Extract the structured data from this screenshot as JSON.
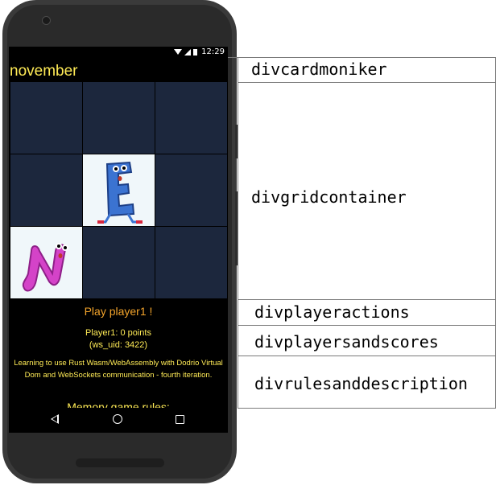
{
  "device": {
    "status_time": "12:29"
  },
  "app": {
    "card_moniker": "november",
    "grid_cards": [
      {
        "state": "closed",
        "letter": ""
      },
      {
        "state": "closed",
        "letter": ""
      },
      {
        "state": "closed",
        "letter": ""
      },
      {
        "state": "closed",
        "letter": ""
      },
      {
        "state": "open",
        "letter": "E"
      },
      {
        "state": "closed",
        "letter": ""
      },
      {
        "state": "open",
        "letter": "N"
      },
      {
        "state": "closed",
        "letter": ""
      },
      {
        "state": "closed",
        "letter": ""
      }
    ],
    "player_action": "Play player1 !",
    "player_score_line1": "Player1: 0 points",
    "player_score_line2": "(ws_uid: 3422)",
    "rules_description": "Learning to use Rust Wasm/WebAssembly with Dodrio Virtual Dom and WebSockets communication - fourth iteration.",
    "rules_title": "Memory game rules:"
  },
  "annotations": {
    "card_moniker": "divcardmoniker",
    "grid_container": "divgridcontainer",
    "player_actions": "divplayeractions",
    "players_and_scores": "divplayersandscores",
    "rules_and_description": "divrulesanddescription"
  },
  "colors": {
    "cell_closed": "#1c273d",
    "cell_open": "#f0f7fa",
    "text_yellow": "#ffeb56",
    "text_orange": "#f3a42b"
  }
}
